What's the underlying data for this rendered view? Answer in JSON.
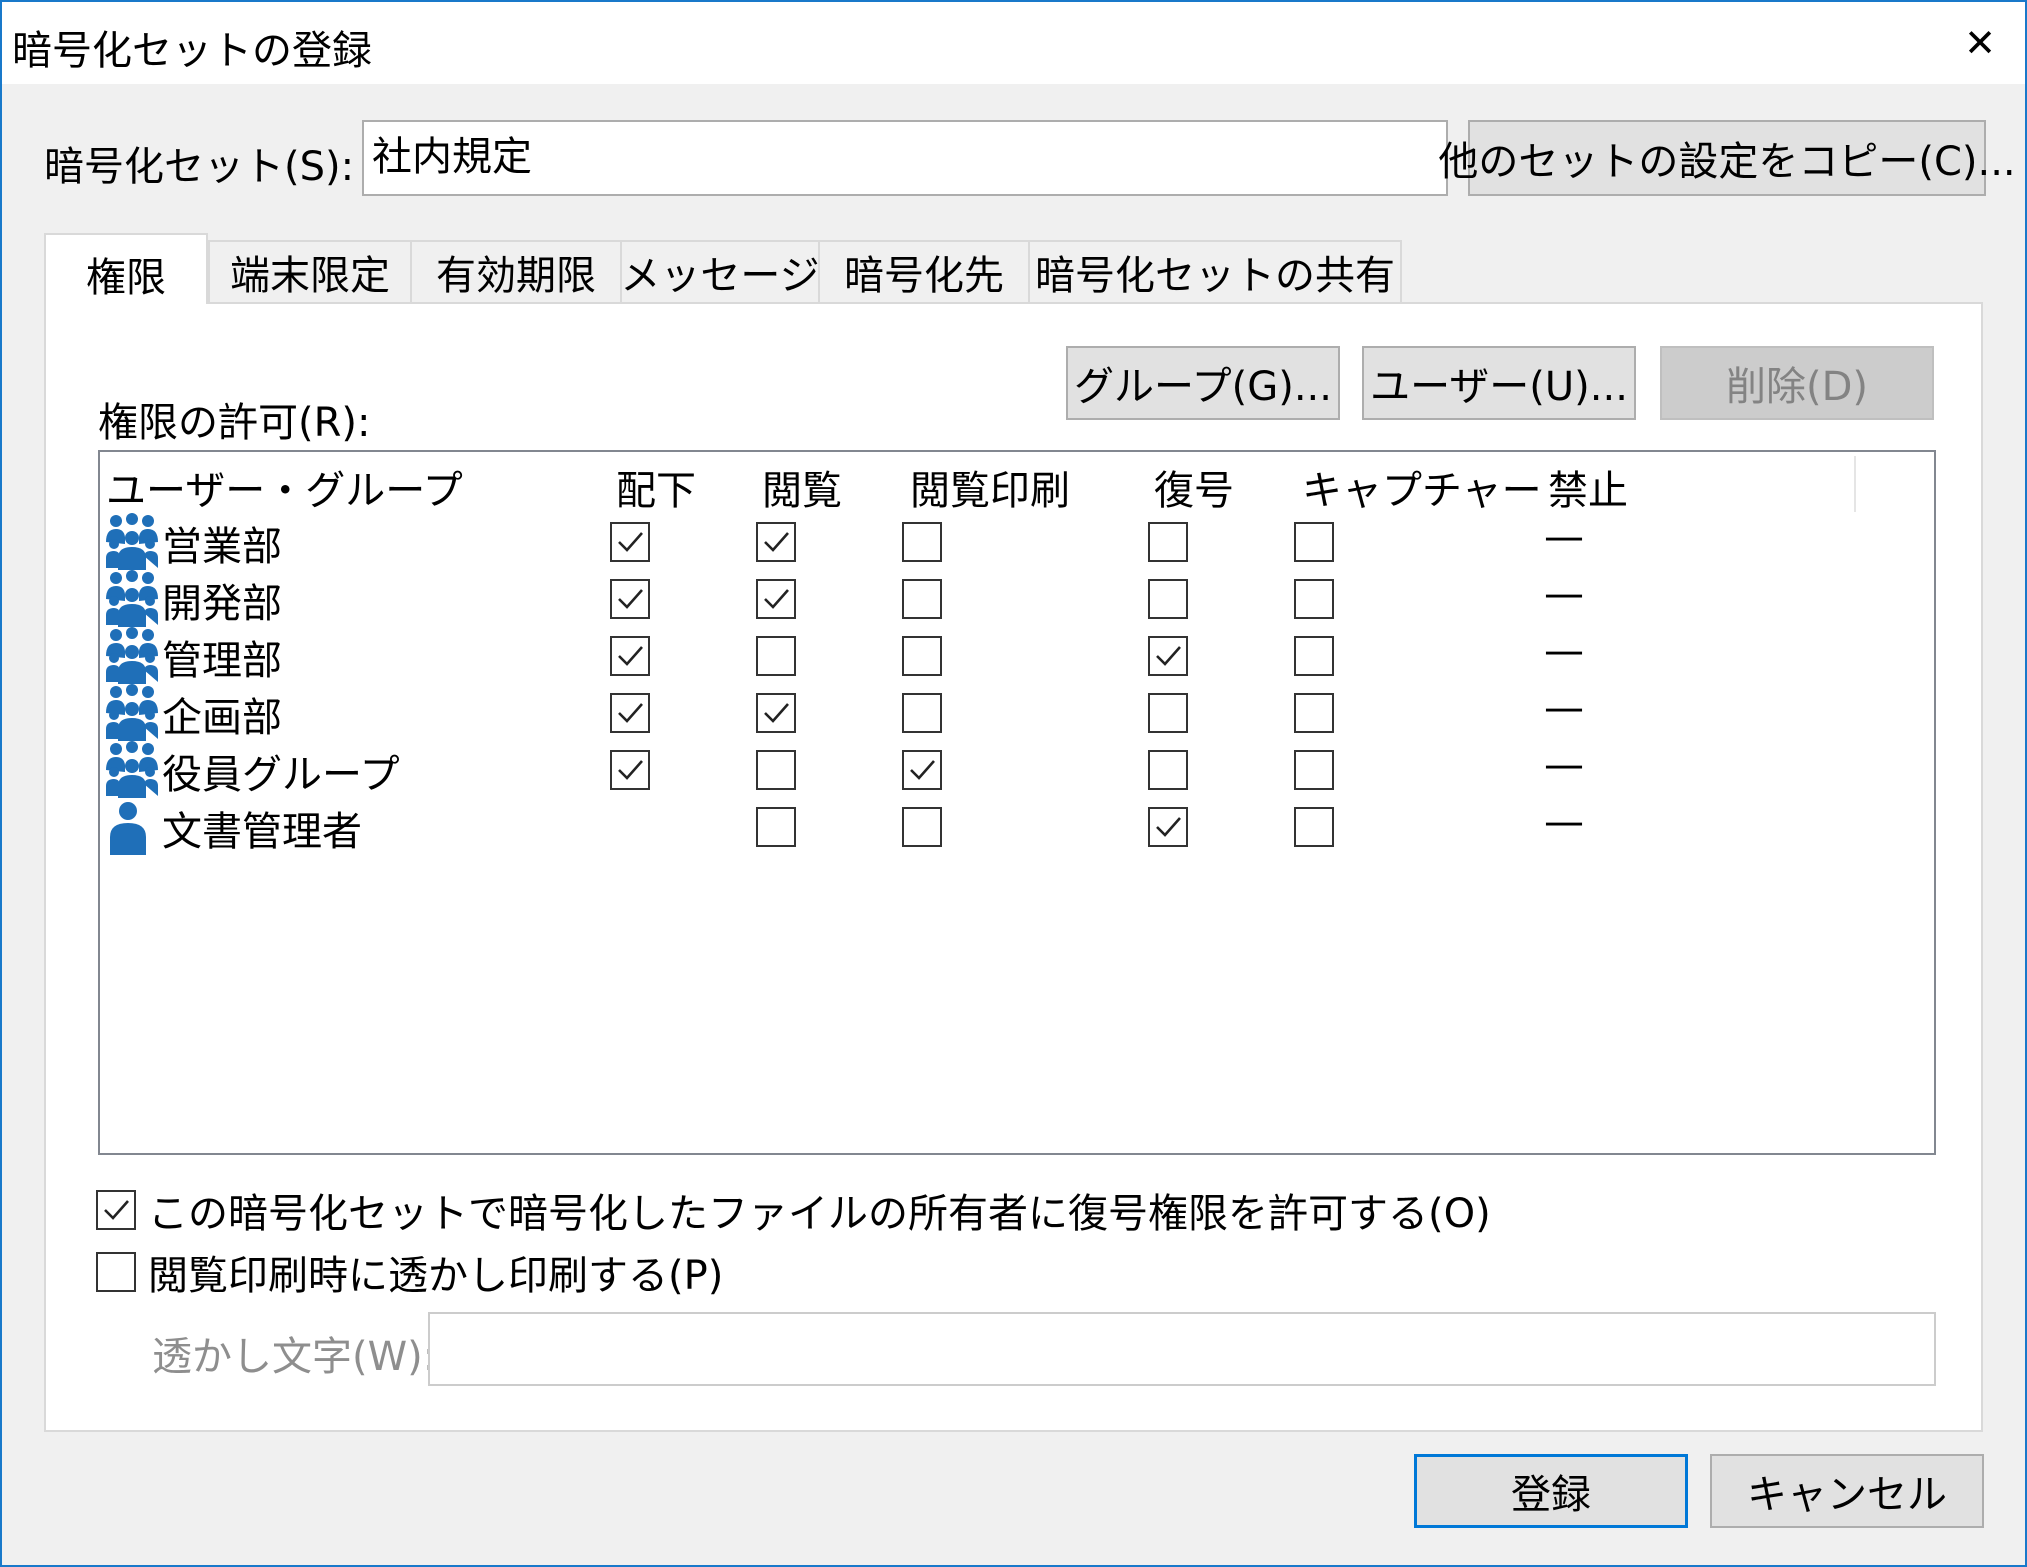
{
  "window": {
    "title": "暗号化セットの登録",
    "close_glyph": "✕"
  },
  "set_field": {
    "label": "暗号化セット(S):",
    "value": "社内規定"
  },
  "copy_button": "他のセットの設定をコピー(C)...",
  "tabs": [
    {
      "label": "権限",
      "active": true
    },
    {
      "label": "端末限定"
    },
    {
      "label": "有効期限"
    },
    {
      "label": "メッセージ"
    },
    {
      "label": "暗号化先"
    },
    {
      "label": "暗号化セットの共有"
    }
  ],
  "permissions": {
    "label": "権限の許可(R):",
    "buttons": {
      "group": "グループ(G)...",
      "user": "ユーザー(U)...",
      "delete": "削除(D)"
    },
    "columns": [
      "ユーザー・グループ",
      "配下",
      "閲覧",
      "閲覧印刷",
      "復号",
      "キャプチャー",
      "禁止"
    ],
    "rows": [
      {
        "name": "営業部",
        "icon": "group-icon",
        "haika": true,
        "etsuran": true,
        "insatsu": false,
        "fukugo": false,
        "capture": false,
        "kinshi": "—"
      },
      {
        "name": "開発部",
        "icon": "group-icon",
        "haika": true,
        "etsuran": true,
        "insatsu": false,
        "fukugo": false,
        "capture": false,
        "kinshi": "—"
      },
      {
        "name": "管理部",
        "icon": "group-icon",
        "haika": true,
        "etsuran": false,
        "insatsu": false,
        "fukugo": true,
        "capture": false,
        "kinshi": "—"
      },
      {
        "name": "企画部",
        "icon": "group-icon",
        "haika": true,
        "etsuran": true,
        "insatsu": false,
        "fukugo": false,
        "capture": false,
        "kinshi": "—"
      },
      {
        "name": "役員グループ",
        "icon": "group-icon",
        "haika": true,
        "etsuran": false,
        "insatsu": true,
        "fukugo": false,
        "capture": false,
        "kinshi": "—"
      },
      {
        "name": "文書管理者",
        "icon": "user-icon",
        "haika": null,
        "etsuran": false,
        "insatsu": false,
        "fukugo": true,
        "capture": false,
        "kinshi": "—"
      }
    ]
  },
  "options": {
    "owner_decrypt": {
      "label": "この暗号化セットで暗号化したファイルの所有者に復号権限を許可する(O)",
      "checked": true
    },
    "watermark_print": {
      "label": "閲覧印刷時に透かし印刷する(P)",
      "checked": false
    },
    "watermark_text": {
      "label": "透かし文字(W):",
      "value": ""
    }
  },
  "footer": {
    "ok": "登録",
    "cancel": "キャンセル"
  },
  "colors": {
    "accent": "#0078d7",
    "border": "#1979ca",
    "icon_blue": "#1f6fb8"
  }
}
